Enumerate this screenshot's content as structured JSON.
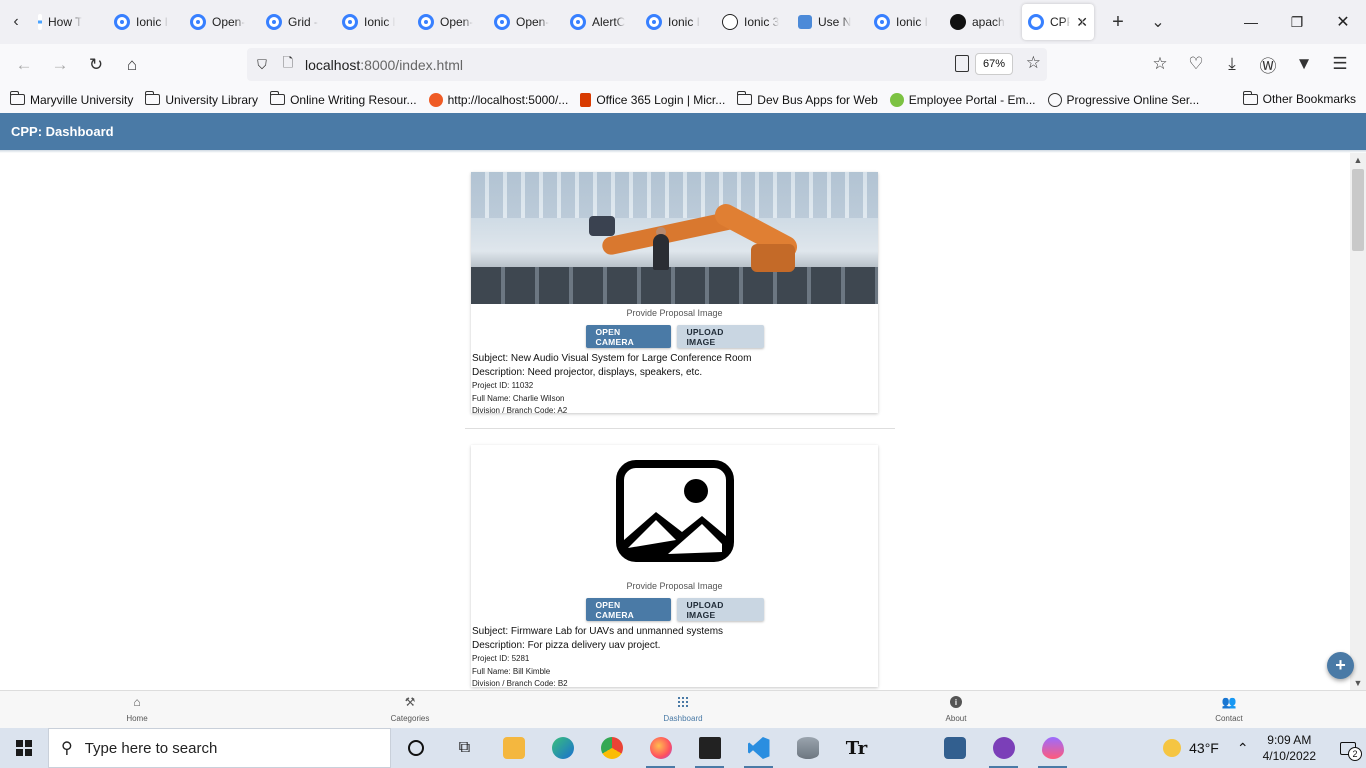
{
  "browser": {
    "tabs": [
      {
        "label": "How T",
        "icon": "page-icon"
      },
      {
        "label": "Ionic I",
        "icon": "ionic-icon"
      },
      {
        "label": "Open-",
        "icon": "ionic-icon"
      },
      {
        "label": "Grid -",
        "icon": "ionic-icon"
      },
      {
        "label": "Ionic l",
        "icon": "ionic-icon"
      },
      {
        "label": "Open-",
        "icon": "ionic-icon"
      },
      {
        "label": "Open-",
        "icon": "ionic-icon"
      },
      {
        "label": "AlertC",
        "icon": "ionic-icon"
      },
      {
        "label": "Ionic I",
        "icon": "ionic-icon"
      },
      {
        "label": "Ionic 3",
        "icon": "globe-icon"
      },
      {
        "label": "Use N",
        "icon": "extension-icon"
      },
      {
        "label": "Ionic I",
        "icon": "ionic-icon"
      },
      {
        "label": "apach",
        "icon": "github-icon"
      },
      {
        "label": "CPP",
        "icon": "ionic-icon",
        "active": true
      }
    ],
    "url_host": "localhost",
    "url_rest": ":8000/index.html",
    "zoom": "67%",
    "bookmarks": [
      {
        "label": "Maryville University",
        "icon": "folder-icon"
      },
      {
        "label": "University Library",
        "icon": "folder-icon"
      },
      {
        "label": "Online Writing Resour...",
        "icon": "folder-icon"
      },
      {
        "label": "http://localhost:5000/...",
        "icon": "postman-icon"
      },
      {
        "label": "Office 365 Login | Micr...",
        "icon": "office-icon"
      },
      {
        "label": "Dev Bus Apps for Web",
        "icon": "folder-icon"
      },
      {
        "label": "Employee Portal - Em...",
        "icon": "portal-icon"
      },
      {
        "label": "Progressive Online Ser...",
        "icon": "globe-icon"
      }
    ],
    "other_bookmarks": "Other Bookmarks"
  },
  "app": {
    "title": "CPP: Dashboard",
    "proposals": [
      {
        "image_label": "Provide Proposal Image",
        "open_camera": "OPEN CAMERA",
        "upload_image": "UPLOAD IMAGE",
        "subject": "Subject: New Audio Visual System for Large Conference Room",
        "description": "Description: Need projector, displays, speakers, etc.",
        "project_id": "Project ID: 11032",
        "full_name": "Full Name: Charlie Wilson",
        "division": "Division / Branch Code: A2"
      },
      {
        "image_label": "Provide Proposal Image",
        "open_camera": "OPEN CAMERA",
        "upload_image": "UPLOAD IMAGE",
        "subject": "Subject: Firmware Lab for UAVs and unmanned systems",
        "description": "Description: For pizza delivery uav project.",
        "project_id": "Project ID: 5281",
        "full_name": "Full Name: Bill Kimble",
        "division": "Division / Branch Code: B2"
      }
    ],
    "fab_label": "+",
    "bottom_tabs": [
      {
        "label": "Home",
        "icon": "home-icon"
      },
      {
        "label": "Categories",
        "icon": "tools-icon"
      },
      {
        "label": "Dashboard",
        "icon": "apps-icon",
        "selected": true
      },
      {
        "label": "About",
        "icon": "info-icon"
      },
      {
        "label": "Contact",
        "icon": "people-icon"
      }
    ]
  },
  "taskbar": {
    "search_placeholder": "Type here to search",
    "weather": "43°F",
    "time": "9:09 AM",
    "date": "4/10/2022",
    "notification_count": "2"
  },
  "colors": {
    "primary": "#4a7aa6",
    "secondary_button": "#c9d6e2",
    "taskbar": "#dbe3ee"
  }
}
